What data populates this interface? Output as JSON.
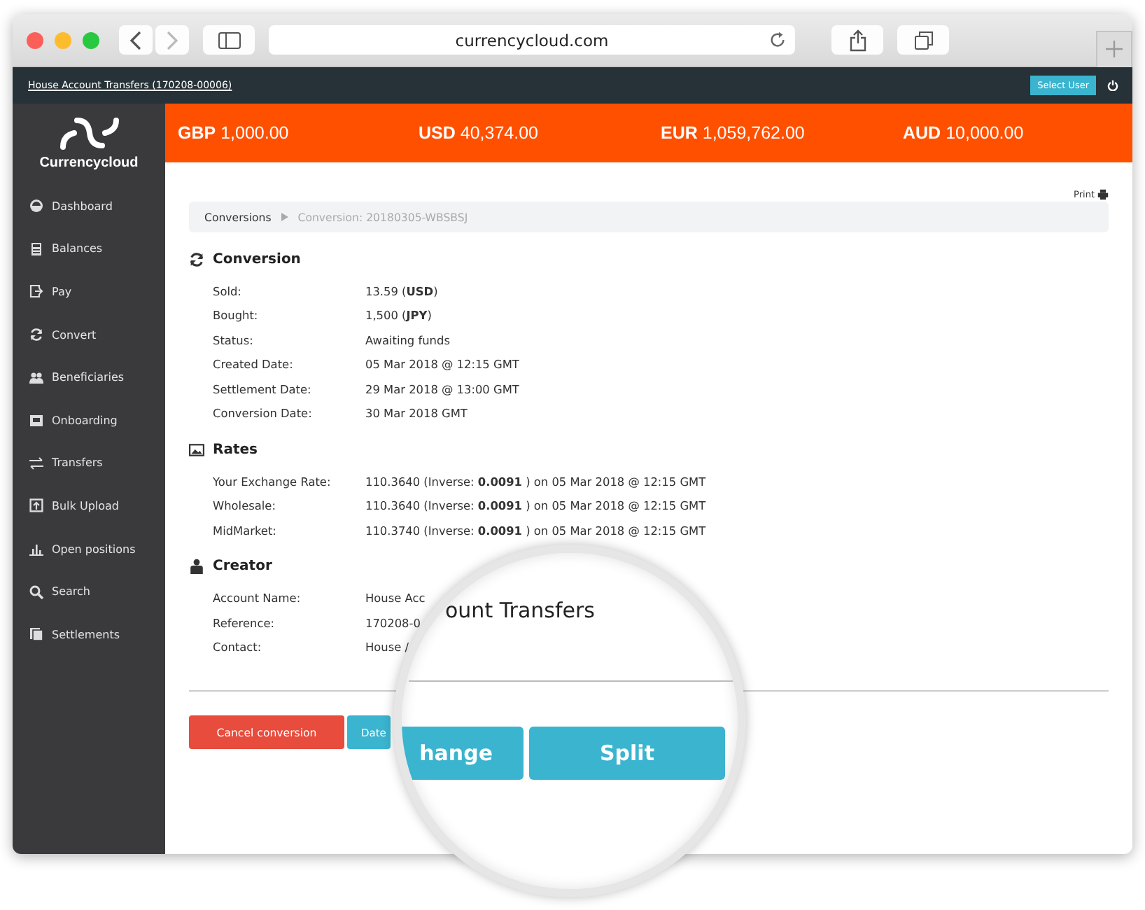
{
  "browser": {
    "url": "currencycloud.com"
  },
  "topbar": {
    "account_link": "House Account Transfers (170208-00006)",
    "select_user_button": "Select User"
  },
  "logo": {
    "name": "Currencycloud"
  },
  "sidebar": {
    "items": [
      {
        "label": "Dashboard"
      },
      {
        "label": "Balances"
      },
      {
        "label": "Pay"
      },
      {
        "label": "Convert"
      },
      {
        "label": "Beneficiaries"
      },
      {
        "label": "Onboarding"
      },
      {
        "label": "Transfers"
      },
      {
        "label": "Bulk Upload"
      },
      {
        "label": "Open positions"
      },
      {
        "label": "Search"
      },
      {
        "label": "Settlements"
      }
    ]
  },
  "balances": [
    {
      "currency": "GBP",
      "amount": "1,000.00"
    },
    {
      "currency": "USD",
      "amount": "40,374.00"
    },
    {
      "currency": "EUR",
      "amount": "1,059,762.00"
    },
    {
      "currency": "AUD",
      "amount": "10,000.00"
    }
  ],
  "print_link": "Print",
  "breadcrumb": [
    {
      "label": "Conversions",
      "current": false
    },
    {
      "label": "Conversion: 20180305-WBSBSJ",
      "current": true
    }
  ],
  "sections": [
    {
      "title": "Conversion",
      "rows": [
        {
          "label": "Sold:",
          "value": "13.59 (**USD**)"
        },
        {
          "label": "Bought:",
          "value": "1,500 (**JPY**)"
        },
        {
          "label": "Status:",
          "value": "Awaiting funds"
        },
        {
          "label": "Created Date:",
          "value": "05 Mar 2018 @ 12:15 GMT"
        },
        {
          "label": "Settlement Date:",
          "value": "29 Mar 2018 @ 13:00 GMT"
        },
        {
          "label": "Conversion Date:",
          "value": "30 Mar 2018 GMT"
        }
      ]
    },
    {
      "title": "Rates",
      "rows": [
        {
          "label": "Your Exchange Rate:",
          "value": "110.3640 (Inverse: **0.0091** ) on 05 Mar 2018 @ 12:15 GMT"
        },
        {
          "label": "Wholesale:",
          "value": "110.3640 (Inverse: **0.0091** ) on 05 Mar 2018 @ 12:15 GMT"
        },
        {
          "label": "MidMarket:",
          "value": "110.3740 (Inverse: **0.0091** ) on 05 Mar 2018 @ 12:15 GMT"
        }
      ]
    },
    {
      "title": "Creator",
      "rows": [
        {
          "label": "Account Name:",
          "value": "House Acc"
        },
        {
          "label": "Reference:",
          "value": "170208-0"
        },
        {
          "label": "Contact:",
          "value": "House /"
        }
      ]
    }
  ],
  "actions": [
    {
      "label": "Cancel conversion",
      "kind": "danger"
    },
    {
      "label": "Date",
      "kind": "info"
    }
  ],
  "magnifier": {
    "heading": "ount Transfers",
    "buttons": [
      {
        "label": "hange"
      },
      {
        "label": "Split"
      }
    ]
  }
}
